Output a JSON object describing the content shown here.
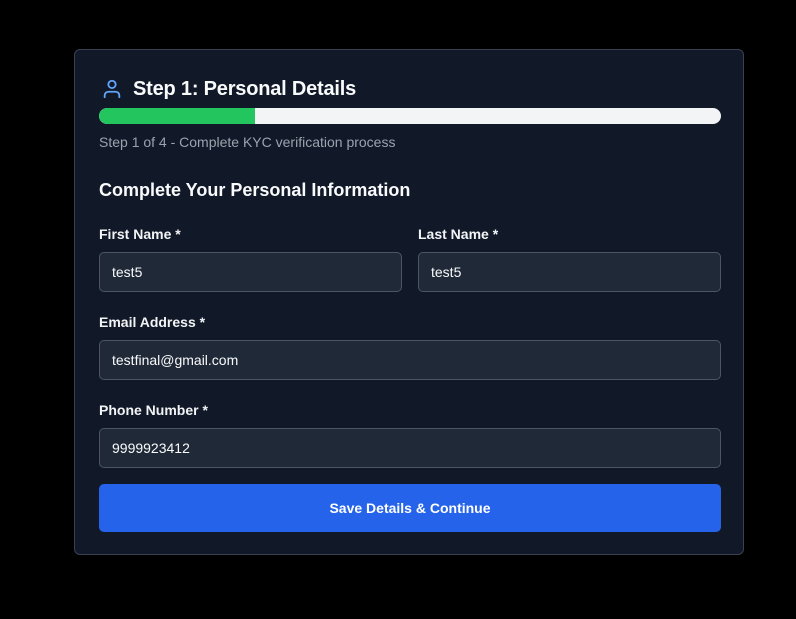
{
  "header": {
    "icon": "user-icon",
    "title": "Step 1: Personal Details"
  },
  "progress": {
    "fraction": 0.25,
    "caption": "Step 1 of 4 - Complete KYC verification process"
  },
  "form": {
    "section_title": "Complete Your Personal Information",
    "first_name": {
      "label": "First Name *",
      "value": "test5"
    },
    "last_name": {
      "label": "Last Name *",
      "value": "test5"
    },
    "email": {
      "label": "Email Address *",
      "value": "testfinal@gmail.com"
    },
    "phone": {
      "label": "Phone Number *",
      "value": "9999923412"
    },
    "submit_label": "Save Details & Continue"
  },
  "colors": {
    "background": "#000000",
    "card": "#111827",
    "accent": "#2563eb",
    "progress_fill": "#22c55e",
    "icon": "#60a5fa"
  }
}
